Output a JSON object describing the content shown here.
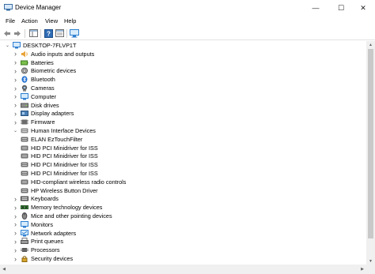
{
  "window": {
    "title": "Device Manager",
    "controls": {
      "minimize": "—",
      "maximize": "☐",
      "close": "✕"
    }
  },
  "menu": [
    "File",
    "Action",
    "View",
    "Help"
  ],
  "colors": {
    "accent": "#1979ca",
    "device_gray": "#6d6d6d",
    "monitor_blue": "#2f7fd0",
    "audio_orange": "#e8a43a",
    "bluetooth_blue": "#1f6fd1"
  },
  "tree": {
    "root": "DESKTOP-7FLVP1T",
    "items": [
      {
        "label": "Audio inputs and outputs",
        "icon": "speaker-icon",
        "expander": "collapsed"
      },
      {
        "label": "Batteries",
        "icon": "battery-icon",
        "expander": "collapsed"
      },
      {
        "label": "Biometric devices",
        "icon": "fingerprint-icon",
        "expander": "collapsed"
      },
      {
        "label": "Bluetooth",
        "icon": "bluetooth-icon",
        "expander": "collapsed"
      },
      {
        "label": "Cameras",
        "icon": "camera-icon",
        "expander": "collapsed"
      },
      {
        "label": "Computer",
        "icon": "computer-icon",
        "expander": "collapsed"
      },
      {
        "label": "Disk drives",
        "icon": "disk-drive-icon",
        "expander": "collapsed"
      },
      {
        "label": "Display adapters",
        "icon": "display-adapter-icon",
        "expander": "collapsed"
      },
      {
        "label": "Firmware",
        "icon": "firmware-icon",
        "expander": "collapsed"
      },
      {
        "label": "Human Interface Devices",
        "icon": "hid-icon",
        "expander": "expanded"
      },
      {
        "label": "ELAN EzTouchFilter",
        "icon": "hid-device-icon",
        "expander": "none",
        "child": true
      },
      {
        "label": "HID PCI Minidriver for ISS",
        "icon": "hid-device-icon",
        "expander": "none",
        "child": true
      },
      {
        "label": "HID PCI Minidriver for ISS",
        "icon": "hid-device-icon",
        "expander": "none",
        "child": true
      },
      {
        "label": "HID PCI Minidriver for ISS",
        "icon": "hid-device-icon",
        "expander": "none",
        "child": true
      },
      {
        "label": "HID PCI Minidriver for ISS",
        "icon": "hid-device-icon",
        "expander": "none",
        "child": true
      },
      {
        "label": "HID-compliant wireless radio controls",
        "icon": "hid-device-icon",
        "expander": "none",
        "child": true
      },
      {
        "label": "HP Wireless Button Driver",
        "icon": "hid-device-icon",
        "expander": "none",
        "child": true
      },
      {
        "label": "Keyboards",
        "icon": "keyboard-icon",
        "expander": "collapsed"
      },
      {
        "label": "Memory technology devices",
        "icon": "memory-icon",
        "expander": "collapsed"
      },
      {
        "label": "Mice and other pointing devices",
        "icon": "mouse-icon",
        "expander": "collapsed"
      },
      {
        "label": "Monitors",
        "icon": "monitor-icon",
        "expander": "collapsed"
      },
      {
        "label": "Network adapters",
        "icon": "network-adapter-icon",
        "expander": "collapsed"
      },
      {
        "label": "Print queues",
        "icon": "printer-icon",
        "expander": "collapsed"
      },
      {
        "label": "Processors",
        "icon": "processor-icon",
        "expander": "collapsed"
      },
      {
        "label": "Security devices",
        "icon": "security-device-icon",
        "expander": "collapsed"
      }
    ]
  }
}
